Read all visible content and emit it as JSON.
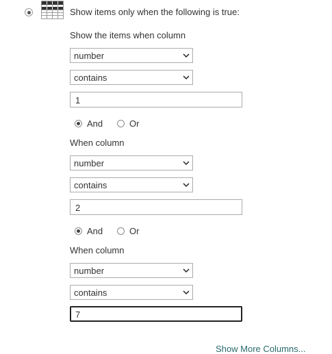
{
  "option": {
    "label": "Show items only when the following is true:"
  },
  "icons": {
    "table": "table-grid-icon",
    "chevron": "chevron-down-icon"
  },
  "conditions": [
    {
      "heading": "Show the items when column",
      "column": "number",
      "operator": "contains",
      "value": "1"
    },
    {
      "heading": "When column",
      "column": "number",
      "operator": "contains",
      "value": "2"
    },
    {
      "heading": "When column",
      "column": "number",
      "operator": "contains",
      "value": "7"
    }
  ],
  "connectors": [
    {
      "and_label": "And",
      "or_label": "Or",
      "selected": "And"
    },
    {
      "and_label": "And",
      "or_label": "Or",
      "selected": "And"
    }
  ],
  "show_more": "Show More Columns..."
}
